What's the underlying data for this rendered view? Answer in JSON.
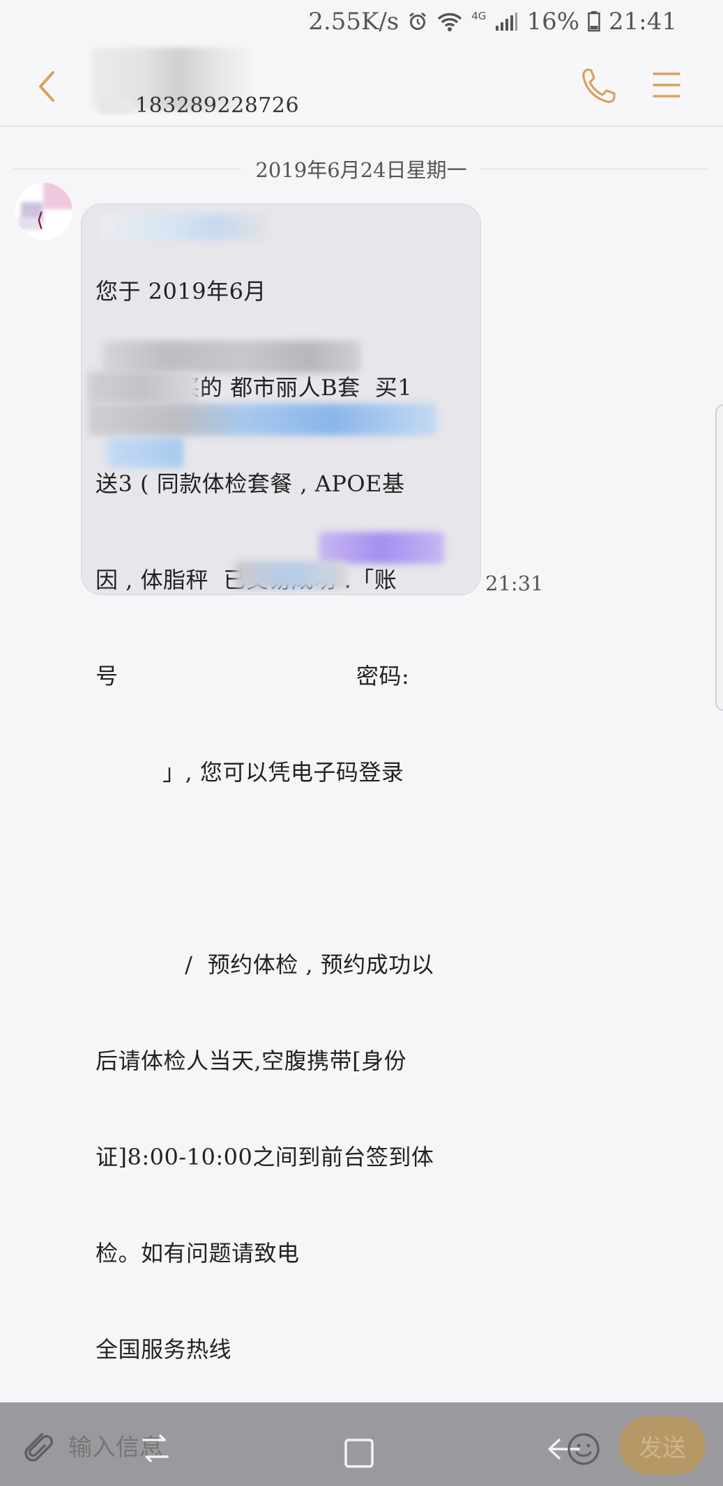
{
  "status_bar": {
    "net_speed": "2.55K/s",
    "network_type": "4G",
    "battery": "16%",
    "time": "21:41"
  },
  "header": {
    "contact_number": "183289228726"
  },
  "date_divider": "2019年6月24日星期一",
  "message": {
    "lines": [
      "您于 2019年6月",
      "24日 购买的 都市丽人B套  买1",
      "送3 ( 同款体检套餐 , APOE基",
      "因 , 体脂秤  已交易成功 .「账",
      "号                                密码:",
      "         」, 您可以凭电子码登录",
      "",
      "            /  预约体检 , 预约成功以",
      "后请体检人当天,空腹携带[身份",
      "证]8:00-10:00之间到前台签到体",
      "检。如有问题请致电",
      "全国服务热线"
    ],
    "time": "21:31"
  },
  "composer": {
    "placeholder": "输入信息",
    "send_label": "发送"
  },
  "colors": {
    "accent": "#d9a15a",
    "background": "#f6f6f8",
    "bubble": "#e7e6ea",
    "composer": "#9a9a9e",
    "send_button": "#b69866"
  },
  "icons": {
    "back": "chevron-left-icon",
    "call": "phone-icon",
    "menu": "menu-icon",
    "attach": "paperclip-icon",
    "emoji": "emoji-icon"
  }
}
